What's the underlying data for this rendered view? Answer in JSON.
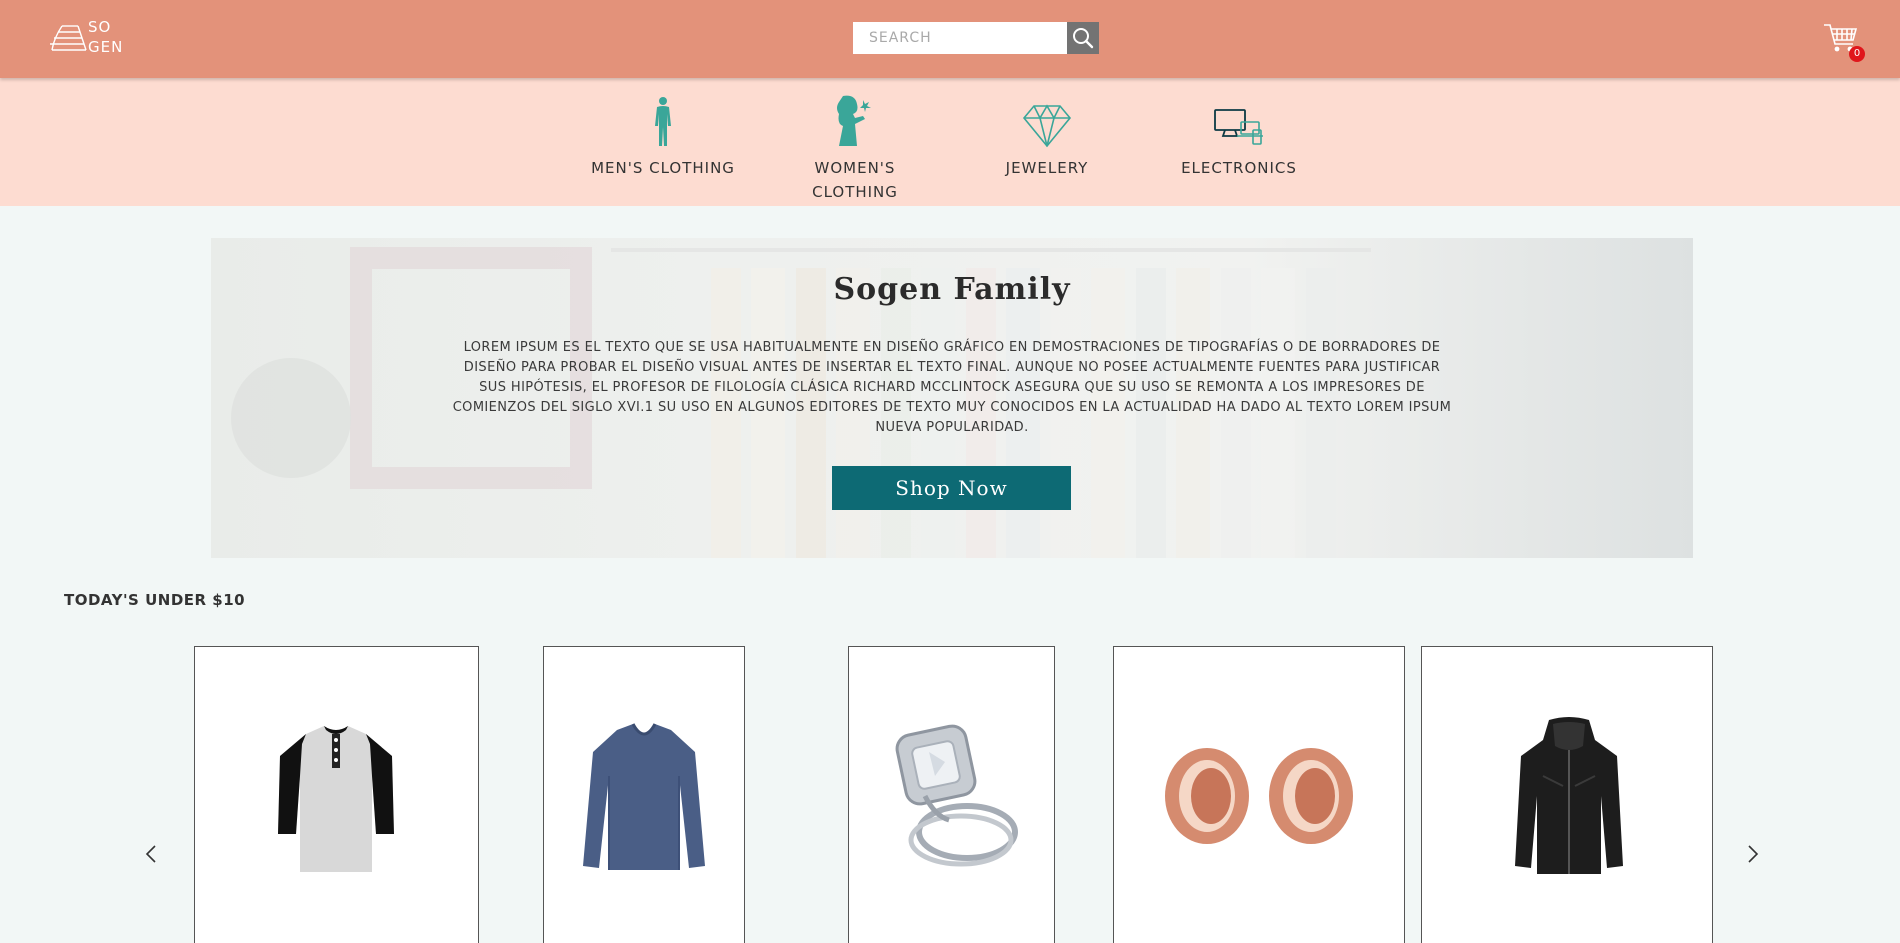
{
  "header": {
    "logo_line1": "SO",
    "logo_line2": "GEN",
    "search_placeholder": "SEARCH",
    "cart_count": "0",
    "colors": {
      "topbar": "#e3927a",
      "badge": "#e0161b"
    }
  },
  "categories": [
    {
      "label": "MEN'S CLOTHING",
      "icon": "man-silhouette-icon"
    },
    {
      "label": "WOMEN'S CLOTHING",
      "icon": "woman-silhouette-icon"
    },
    {
      "label": "JEWELERY",
      "icon": "diamond-icon"
    },
    {
      "label": "ELECTRONICS",
      "icon": "devices-icon"
    }
  ],
  "hero": {
    "title": "Sogen Family",
    "text": "Lorem ipsum es el texto que se usa habitualmente en diseño gráfico en demostraciones de tipografías o de borradores de diseño para probar el diseño visual antes de insertar el texto final. Aunque no posee actualmente fuentes para justificar sus hipótesis, el profesor de filología clásica Richard McClintock asegura que su uso se remonta a los impresores de comienzos del siglo XVI.1 Su uso en algunos editores de texto muy conocidos en la actualidad ha dado al texto Lorem Ipsum nueva popularidad.",
    "button": "Shop Now",
    "colors": {
      "button": "#0d6a74"
    }
  },
  "deals": {
    "title": "TODAY'S UNDER $10",
    "products": [
      {
        "image": "henley-shirt-image"
      },
      {
        "image": "blue-sweater-image"
      },
      {
        "image": "diamond-ring-image"
      },
      {
        "image": "rose-gold-plugs-image"
      },
      {
        "image": "black-jacket-image"
      }
    ]
  }
}
